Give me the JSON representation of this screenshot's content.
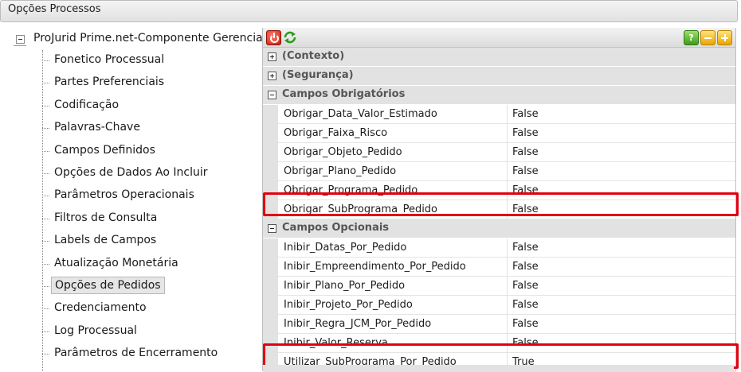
{
  "window": {
    "title": "Opções Processos"
  },
  "tree": {
    "root_label": "ProJurid Prime.net-Componente Gerencial",
    "items": [
      {
        "label": "Fonetico Processual"
      },
      {
        "label": "Partes Preferenciais"
      },
      {
        "label": "Codificação"
      },
      {
        "label": "Palavras-Chave"
      },
      {
        "label": "Campos Definidos"
      },
      {
        "label": "Opções de Dados Ao Incluir"
      },
      {
        "label": "Parâmetros Operacionais"
      },
      {
        "label": "Filtros de Consulta"
      },
      {
        "label": "Labels de Campos"
      },
      {
        "label": "Atualização Monetária"
      },
      {
        "label": "Opções de Pedidos"
      },
      {
        "label": "Credenciamento"
      },
      {
        "label": "Log Processual"
      },
      {
        "label": "Parâmetros de Encerramento"
      }
    ],
    "selected": "Opções de Pedidos"
  },
  "toolbar": {
    "icons": [
      "power-icon",
      "refresh-icon",
      "help-icon",
      "collapse-icon",
      "expand-icon"
    ],
    "help_label": "?"
  },
  "grid": {
    "categories": [
      {
        "label": "(Contexto)",
        "expanded": false,
        "rows": []
      },
      {
        "label": "(Segurança)",
        "expanded": false,
        "rows": []
      },
      {
        "label": "Campos Obrigatórios",
        "expanded": true,
        "rows": [
          {
            "name": "Obrigar_Data_Valor_Estimado",
            "value": "False"
          },
          {
            "name": "Obrigar_Faixa_Risco",
            "value": "False"
          },
          {
            "name": "Obrigar_Objeto_Pedido",
            "value": "False"
          },
          {
            "name": "Obrigar_Plano_Pedido",
            "value": "False"
          },
          {
            "name": "Obrigar_Programa_Pedido",
            "value": "False"
          },
          {
            "name": "Obrigar_SubPrograma_Pedido",
            "value": "False"
          }
        ]
      },
      {
        "label": "Campos Opcionais",
        "expanded": true,
        "rows": [
          {
            "name": "Inibir_Datas_Por_Pedido",
            "value": "False"
          },
          {
            "name": "Inibir_Empreendimento_Por_Pedido",
            "value": "False"
          },
          {
            "name": "Inibir_Plano_Por_Pedido",
            "value": "False"
          },
          {
            "name": "Inibir_Projeto_Por_Pedido",
            "value": "False"
          },
          {
            "name": "Inibir_Regra_JCM_Por_Pedido",
            "value": "False"
          },
          {
            "name": "Inibir_Valor_Reserva",
            "value": "False"
          },
          {
            "name": "Utilizar_SubPrograma_Por_Pedido",
            "value": "True"
          }
        ]
      }
    ],
    "highlighted_rows": [
      "Obrigar_SubPrograma_Pedido",
      "Utilizar_SubPrograma_Por_Pedido"
    ],
    "highlight_color": "#e3000f"
  }
}
